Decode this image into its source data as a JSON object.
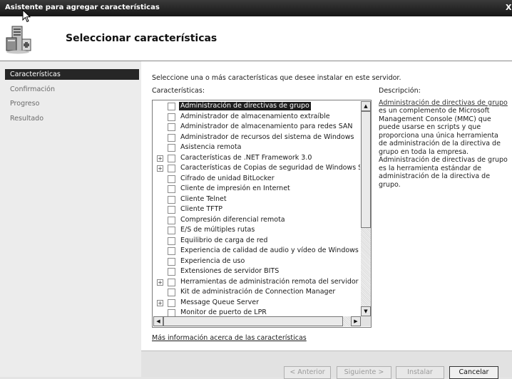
{
  "window": {
    "title": "Asistente para agregar características",
    "close_label": "X"
  },
  "header": {
    "title": "Seleccionar características"
  },
  "nav": {
    "items": [
      {
        "label": "Características"
      },
      {
        "label": "Confirmación"
      },
      {
        "label": "Progreso"
      },
      {
        "label": "Resultado"
      }
    ],
    "active_index": 0
  },
  "main": {
    "intro": "Seleccione una o más características que desee instalar en este servidor.",
    "list_label": "Características:",
    "description_label": "Descripción:",
    "description_link": "Administración de directivas de grupo",
    "description_text": "es un complemento de Microsoft Management Console (MMC) que puede usarse en scripts y que proporciona una única herramienta de administración de la directiva de grupo en toda la empresa. Administración de directivas de grupo es la herramienta estándar de administración de la directiva de grupo.",
    "more_info": "Más información acerca de las características",
    "features": [
      {
        "label": "Administración de directivas de grupo",
        "expandable": false,
        "selected": true
      },
      {
        "label": "Administrador de almacenamiento extraíble",
        "expandable": false
      },
      {
        "label": "Administrador de almacenamiento para redes SAN",
        "expandable": false
      },
      {
        "label": "Administrador de recursos del sistema de Windows",
        "expandable": false
      },
      {
        "label": "Asistencia remota",
        "expandable": false
      },
      {
        "label": "Características de .NET Framework 3.0",
        "expandable": true
      },
      {
        "label": "Características de Copias de seguridad de Windows Serve",
        "expandable": true
      },
      {
        "label": "Cifrado de unidad BitLocker",
        "expandable": false
      },
      {
        "label": "Cliente de impresión en Internet",
        "expandable": false
      },
      {
        "label": "Cliente Telnet",
        "expandable": false
      },
      {
        "label": "Cliente TFTP",
        "expandable": false
      },
      {
        "label": "Compresión diferencial remota",
        "expandable": false
      },
      {
        "label": "E/S de múltiples rutas",
        "expandable": false
      },
      {
        "label": "Equilibrio de carga de red",
        "expandable": false
      },
      {
        "label": "Experiencia de calidad de audio y vídeo de Windows (qWa",
        "expandable": false
      },
      {
        "label": "Experiencia de uso",
        "expandable": false
      },
      {
        "label": "Extensiones de servidor BITS",
        "expandable": false
      },
      {
        "label": "Herramientas de administración remota del servidor",
        "expandable": true
      },
      {
        "label": "Kit de administración de Connection Manager",
        "expandable": false
      },
      {
        "label": "Message Queue Server",
        "expandable": true
      },
      {
        "label": "Monitor de puerto de LPR",
        "expandable": false
      }
    ]
  },
  "buttons": {
    "back": "< Anterior",
    "next": "Siguiente >",
    "install": "Instalar",
    "cancel": "Cancelar"
  }
}
